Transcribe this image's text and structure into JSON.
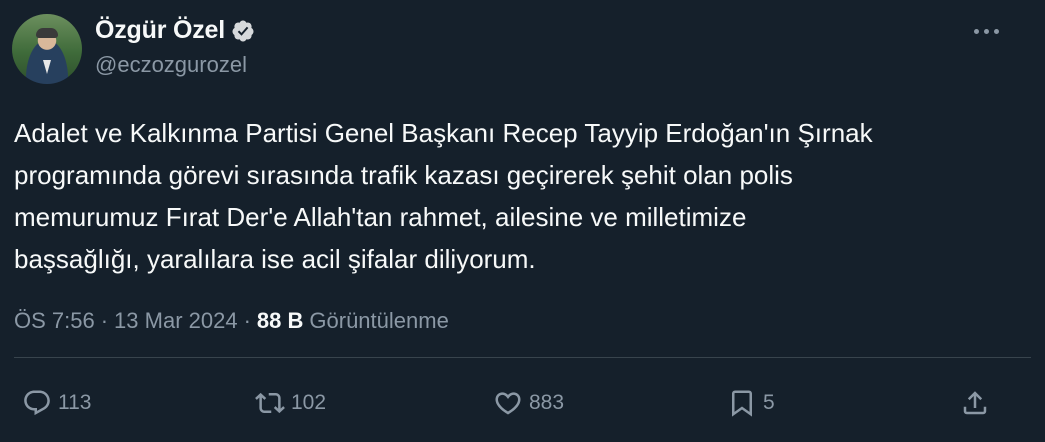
{
  "author": {
    "display_name": "Özgür Özel",
    "handle": "@eczozgurozel",
    "verified": true
  },
  "tweet": {
    "lines": [
      "Adalet ve Kalkınma Partisi Genel Başkanı Recep Tayyip Erdoğan'ın Şırnak",
      "programında görevi sırasında trafik kazası geçirerek şehit olan polis",
      "memurumuz Fırat Der'e Allah'tan rahmet, ailesine ve milletimize",
      "başsağlığı, yaralılara ise acil şifalar diliyorum."
    ]
  },
  "meta": {
    "time": "ÖS 7:56",
    "dot1": "·",
    "date": "13 Mar 2024",
    "dot2": "·",
    "views_count": "88 B",
    "views_label": "Görüntülenme"
  },
  "actions": {
    "reply_count": "113",
    "retweet_count": "102",
    "like_count": "883",
    "bookmark_count": "5"
  },
  "colors": {
    "background": "#15202b",
    "text_primary": "#f7f9f9",
    "text_secondary": "#8b98a5",
    "divider": "#38444d"
  }
}
